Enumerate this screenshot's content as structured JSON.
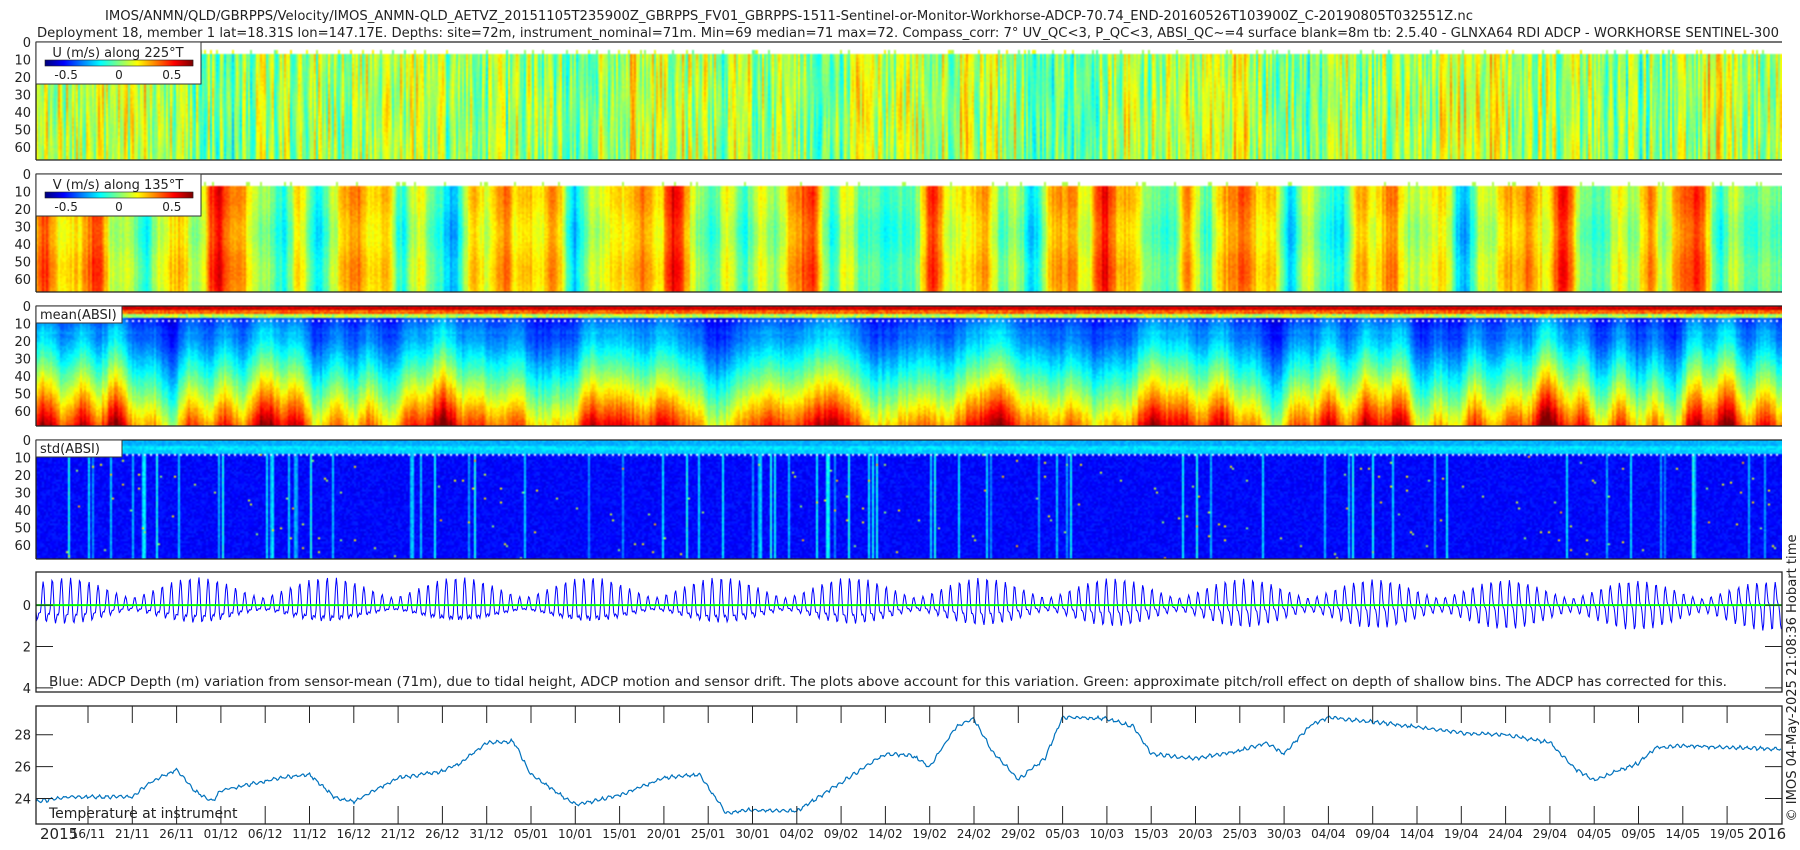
{
  "header": {
    "title_line1": "IMOS/ANMN/QLD/GBRPPS/Velocity/IMOS_ANMN-QLD_AETVZ_20151105T235900Z_GBRPPS_FV01_GBRPPS-1511-Sentinel-or-Monitor-Workhorse-ADCP-70.74_END-20160526T103900Z_C-20190805T032551Z.nc",
    "title_line2": "Deployment 18, member 1 lat=18.31S lon=147.17E. Depths: site=72m, instrument_nominal=71m. Min=69 median=71 max=72. Compass_corr: 7° UV_QC<3, P_QC<3, ABSI_QC~=4 surface blank=8m tb: 2.5.40 - GLNXA64 RDI ADCP - WORKHORSE SENTINEL-300"
  },
  "footer": {
    "credit": "© IMOS 04-May-2025 21:08:36 Hobart time"
  },
  "colors": {
    "depth_line": "#0000ff",
    "pitch_roll_line": "#00ff00",
    "temperature_line": "#0072bd",
    "colormap": "jet"
  },
  "chart_data": [
    {
      "type": "heatmap",
      "label": "U (m/s) along 225°T",
      "colorbar_ticks": [
        "-0.5",
        "0",
        "0.5"
      ],
      "clim": [
        -0.7,
        0.7
      ],
      "yticks": [
        "0",
        "10",
        "20",
        "30",
        "40",
        "50",
        "60"
      ],
      "ylim": [
        0,
        67
      ],
      "y_reversed": true
    },
    {
      "type": "heatmap",
      "label": "V (m/s) along 135°T",
      "colorbar_ticks": [
        "-0.5",
        "0",
        "0.5"
      ],
      "clim": [
        -0.7,
        0.7
      ],
      "yticks": [
        "0",
        "10",
        "20",
        "30",
        "40",
        "50",
        "60"
      ],
      "ylim": [
        0,
        67
      ],
      "y_reversed": true
    },
    {
      "type": "heatmap",
      "label": "mean(ABSI)",
      "yticks": [
        "0",
        "10",
        "20",
        "30",
        "40",
        "50",
        "60"
      ],
      "ylim": [
        0,
        67
      ],
      "y_reversed": true
    },
    {
      "type": "heatmap",
      "label": "std(ABSI)",
      "yticks": [
        "0",
        "10",
        "20",
        "30",
        "40",
        "50",
        "60"
      ],
      "ylim": [
        0,
        67
      ],
      "y_reversed": true
    },
    {
      "type": "line",
      "annotation": "Blue: ADCP Depth (m) variation from sensor-mean (71m), due to tidal height, ADCP motion and sensor drift. The plots above account for this variation. Green: approximate pitch/roll effect on depth of shallow bins. The ADCP has corrected for this.",
      "yticks": [
        "0",
        "2",
        "4"
      ],
      "ylim": [
        -1.6,
        4.2
      ],
      "y_reversed": true
    },
    {
      "type": "line",
      "label": "Temperature at instrument",
      "yticks": [
        "24",
        "26",
        "28"
      ],
      "ylim": [
        22.4,
        29.8
      ],
      "x": [
        "2015-11-10",
        "2015-11-14",
        "2015-11-21",
        "2015-11-23",
        "2015-11-26",
        "2015-11-28",
        "2015-11-30",
        "2015-12-01",
        "2015-12-06",
        "2015-12-09",
        "2015-12-11",
        "2015-12-14",
        "2015-12-16",
        "2015-12-21",
        "2015-12-26",
        "2015-12-28",
        "2015-12-31",
        "2016-01-03",
        "2016-01-05",
        "2016-01-10",
        "2016-01-15",
        "2016-01-20",
        "2016-01-24",
        "2016-01-27",
        "2016-01-30",
        "2016-02-04",
        "2016-02-09",
        "2016-02-14",
        "2016-02-17",
        "2016-02-19",
        "2016-02-22",
        "2016-02-24",
        "2016-02-26",
        "2016-02-29",
        "2016-03-03",
        "2016-03-05",
        "2016-03-10",
        "2016-03-13",
        "2016-03-15",
        "2016-03-20",
        "2016-03-25",
        "2016-03-28",
        "2016-03-30",
        "2016-04-02",
        "2016-04-04",
        "2016-04-09",
        "2016-04-14",
        "2016-04-19",
        "2016-04-24",
        "2016-04-29",
        "2016-05-02",
        "2016-05-04",
        "2016-05-06",
        "2016-05-09",
        "2016-05-11",
        "2016-05-14",
        "2016-05-19",
        "2016-05-25"
      ],
      "y": [
        23.8,
        24.1,
        24.1,
        25.0,
        25.8,
        24.5,
        23.8,
        24.5,
        25.1,
        25.4,
        25.5,
        24.0,
        23.8,
        25.3,
        25.7,
        26.2,
        27.5,
        27.6,
        25.5,
        23.6,
        24.2,
        25.3,
        25.5,
        23.1,
        23.3,
        23.2,
        25.0,
        26.8,
        26.7,
        26.0,
        28.5,
        29.0,
        27.0,
        25.2,
        26.5,
        29.1,
        29.0,
        28.5,
        26.8,
        26.5,
        27.0,
        27.5,
        26.8,
        28.6,
        29.1,
        28.8,
        28.5,
        28.1,
        28.0,
        27.5,
        25.8,
        25.1,
        25.6,
        26.2,
        27.2,
        27.3,
        27.2,
        27.1
      ]
    }
  ],
  "xaxis": {
    "start_year": "2015",
    "end_year": "2016",
    "tick_labels": [
      "16/11",
      "21/11",
      "26/11",
      "01/12",
      "06/12",
      "11/12",
      "16/12",
      "21/12",
      "26/12",
      "31/12",
      "05/01",
      "10/01",
      "15/01",
      "20/01",
      "25/01",
      "30/01",
      "04/02",
      "09/02",
      "14/02",
      "19/02",
      "24/02",
      "29/02",
      "05/03",
      "10/03",
      "15/03",
      "20/03",
      "25/03",
      "30/03",
      "04/04",
      "09/04",
      "14/04",
      "19/04",
      "24/04",
      "29/04",
      "04/05",
      "09/05",
      "14/05",
      "19/05"
    ]
  }
}
